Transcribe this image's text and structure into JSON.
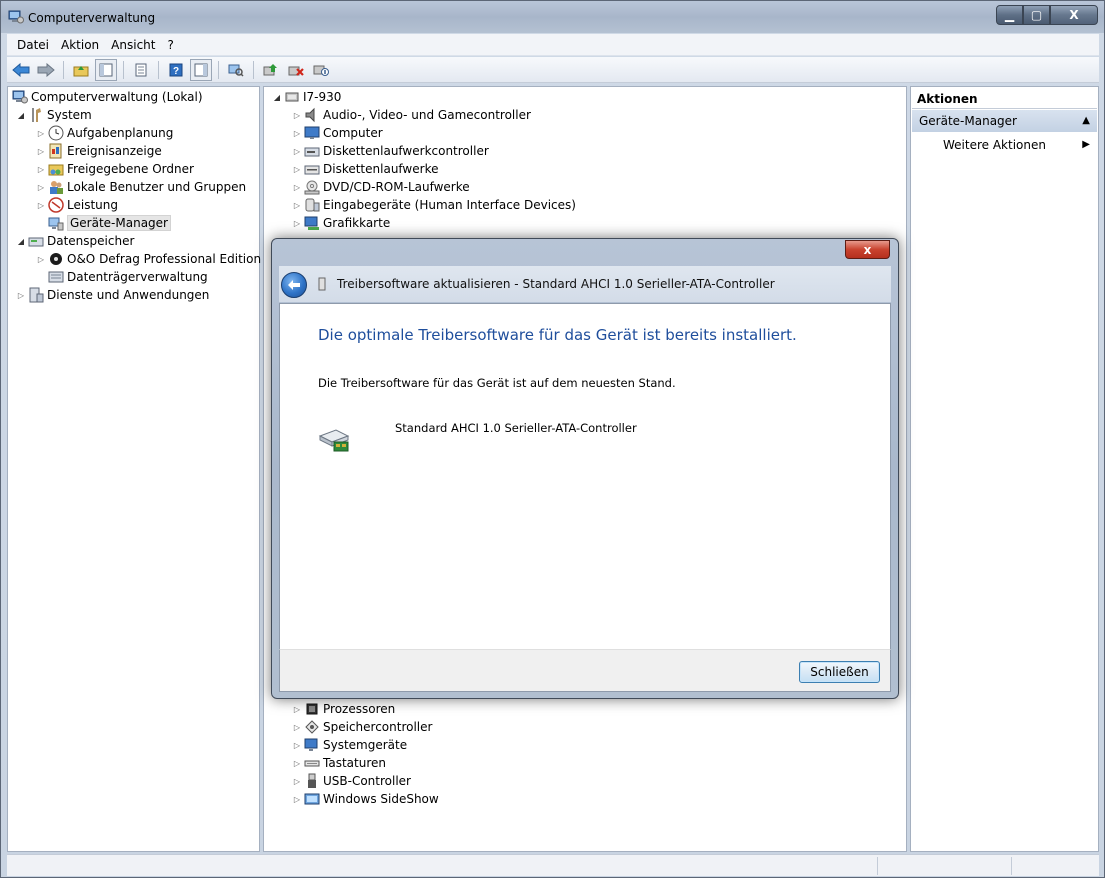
{
  "window": {
    "title": "Computerverwaltung"
  },
  "menu": [
    "Datei",
    "Aktion",
    "Ansicht",
    "?"
  ],
  "window_buttons": {
    "minimize": "▁",
    "maximize": "▢",
    "close": "X"
  },
  "toolbar_icons": [
    "back-arrow-icon",
    "forward-arrow-icon",
    "up-folder-icon",
    "show-hide-tree-icon",
    "properties-icon",
    "help-icon",
    "action-pane-icon",
    "scan-hardware-icon",
    "update-driver-icon",
    "uninstall-icon",
    "disable-device-icon"
  ],
  "left_tree": {
    "root": "Computerverwaltung (Lokal)",
    "system": "System",
    "system_items": [
      "Aufgabenplanung",
      "Ereignisanzeige",
      "Freigegebene Ordner",
      "Lokale Benutzer und Gruppen",
      "Leistung",
      "Geräte-Manager"
    ],
    "storage": "Datenspeicher",
    "storage_items": [
      "O&O Defrag Professional Edition",
      "Datenträgerverwaltung"
    ],
    "services": "Dienste und Anwendungen"
  },
  "device_tree": {
    "root": "I7-930",
    "items_top": [
      "Audio-, Video- und Gamecontroller",
      "Computer",
      "Diskettenlaufwerkcontroller",
      "Diskettenlaufwerke",
      "DVD/CD-ROM-Laufwerke",
      "Eingabegeräte (Human Interface Devices)",
      "Grafikkarte"
    ],
    "items_bottom": [
      "Prozessoren",
      "Speichercontroller",
      "Systemgeräte",
      "Tastaturen",
      "USB-Controller",
      "Windows SideShow"
    ]
  },
  "actions": {
    "header": "Aktionen",
    "section": "Geräte-Manager",
    "item": "Weitere Aktionen"
  },
  "dialog": {
    "title": "Treibersoftware aktualisieren - Standard AHCI 1.0 Serieller-ATA-Controller",
    "heading": "Die optimale Treibersoftware für das Gerät ist bereits installiert.",
    "text": "Die Treibersoftware für das Gerät ist auf dem neuesten Stand.",
    "device_name": "Standard AHCI 1.0 Serieller-ATA-Controller",
    "close_button": "Schließen",
    "close_x": "x"
  }
}
